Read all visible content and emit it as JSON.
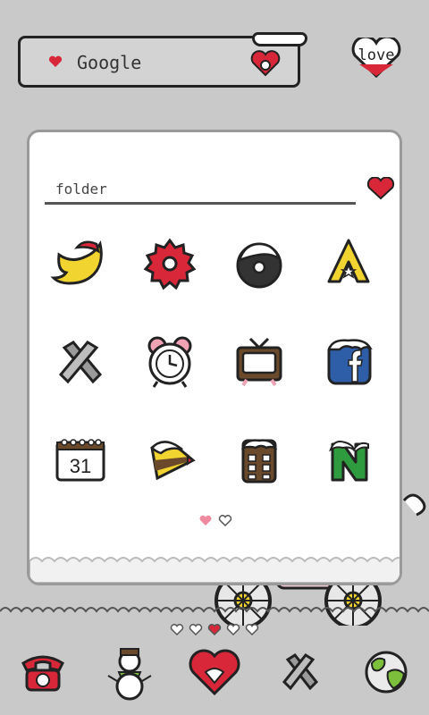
{
  "search": {
    "label": "Google"
  },
  "love_widget": {
    "label": "love"
  },
  "folder": {
    "name": "folder",
    "apps": [
      {
        "icon": "twitter-bird-icon"
      },
      {
        "icon": "settings-gear-icon"
      },
      {
        "icon": "donut-icon"
      },
      {
        "icon": "app-store-a-icon"
      },
      {
        "icon": "tools-icon"
      },
      {
        "icon": "alarm-clock-icon"
      },
      {
        "icon": "tv-icon"
      },
      {
        "icon": "facebook-icon"
      },
      {
        "icon": "calendar-icon"
      },
      {
        "icon": "cake-slice-icon"
      },
      {
        "icon": "calculator-icon"
      },
      {
        "icon": "naver-n-icon"
      }
    ],
    "calendar_day": "31",
    "page_count": 2,
    "current_page": 1
  },
  "home_pages": {
    "count": 5,
    "current": 3
  },
  "dock": [
    {
      "icon": "phone-icon"
    },
    {
      "icon": "snowman-icon"
    },
    {
      "icon": "heart-icon"
    },
    {
      "icon": "tools-icon"
    },
    {
      "icon": "globe-icon"
    }
  ],
  "colors": {
    "background": "#c9c9c9",
    "accent_red": "#d9273a",
    "accent_yellow": "#f2d431",
    "outline": "#222222"
  }
}
